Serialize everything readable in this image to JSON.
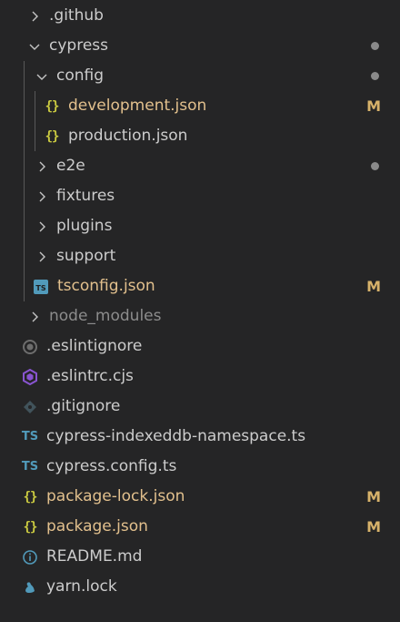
{
  "explorer": {
    "items": [
      {
        "label": ".github",
        "kind": "folder",
        "expanded": false,
        "depth": 0,
        "icon": "chevron-right-icon"
      },
      {
        "label": "cypress",
        "kind": "folder",
        "expanded": true,
        "depth": 0,
        "icon": "chevron-down-icon",
        "decoration": "dot"
      },
      {
        "label": "config",
        "kind": "folder",
        "expanded": true,
        "depth": 1,
        "icon": "chevron-down-icon",
        "decoration": "dot"
      },
      {
        "label": "development.json",
        "kind": "file",
        "depth": 2,
        "icon": "json-icon",
        "status": "M"
      },
      {
        "label": "production.json",
        "kind": "file",
        "depth": 2,
        "icon": "json-icon"
      },
      {
        "label": "e2e",
        "kind": "folder",
        "expanded": false,
        "depth": 1,
        "icon": "chevron-right-icon",
        "decoration": "dot"
      },
      {
        "label": "fixtures",
        "kind": "folder",
        "expanded": false,
        "depth": 1,
        "icon": "chevron-right-icon"
      },
      {
        "label": "plugins",
        "kind": "folder",
        "expanded": false,
        "depth": 1,
        "icon": "chevron-right-icon"
      },
      {
        "label": "support",
        "kind": "folder",
        "expanded": false,
        "depth": 1,
        "icon": "chevron-right-icon"
      },
      {
        "label": "tsconfig.json",
        "kind": "file",
        "depth": 1,
        "icon": "tsconfig-icon",
        "status": "M"
      },
      {
        "label": "node_modules",
        "kind": "folder",
        "expanded": false,
        "depth": 0,
        "icon": "chevron-right-icon",
        "ignored": true
      },
      {
        "label": ".eslintignore",
        "kind": "file",
        "depth": 0,
        "icon": "eslintignore-icon"
      },
      {
        "label": ".eslintrc.cjs",
        "kind": "file",
        "depth": 0,
        "icon": "eslint-icon"
      },
      {
        "label": ".gitignore",
        "kind": "file",
        "depth": 0,
        "icon": "git-icon"
      },
      {
        "label": "cypress-indexeddb-namespace.ts",
        "kind": "file",
        "depth": 0,
        "icon": "typescript-icon"
      },
      {
        "label": "cypress.config.ts",
        "kind": "file",
        "depth": 0,
        "icon": "typescript-icon"
      },
      {
        "label": "package-lock.json",
        "kind": "file",
        "depth": 0,
        "icon": "json-icon",
        "status": "M"
      },
      {
        "label": "package.json",
        "kind": "file",
        "depth": 0,
        "icon": "json-icon",
        "status": "M"
      },
      {
        "label": "README.md",
        "kind": "file",
        "depth": 0,
        "icon": "info-icon"
      },
      {
        "label": "yarn.lock",
        "kind": "file",
        "depth": 0,
        "icon": "yarn-icon"
      }
    ]
  },
  "glyphs": {
    "json": "{}",
    "ts": "TS"
  },
  "colors": {
    "background": "#252526",
    "text": "#cccccc",
    "modified": "#e2c08d",
    "ignored": "#8c8c8c",
    "json": "#cbcb41",
    "typescript": "#519aba",
    "dot": "#8a8a8a"
  }
}
